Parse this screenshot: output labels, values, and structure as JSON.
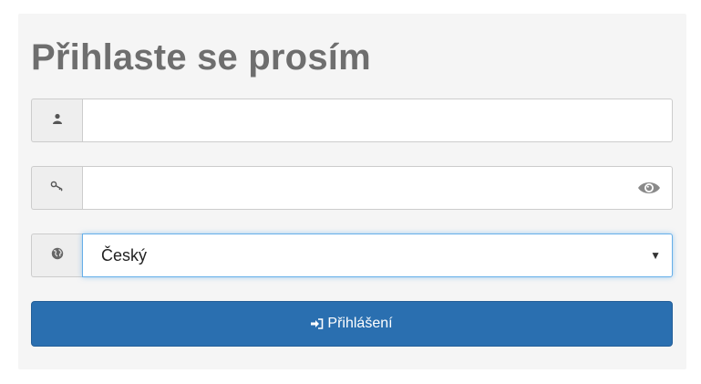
{
  "login": {
    "title": "Přihlaste se prosím",
    "username": {
      "icon": "user-icon",
      "value": "",
      "placeholder": ""
    },
    "password": {
      "icon": "key-icon",
      "toggle_icon": "eye-icon",
      "value": "",
      "placeholder": ""
    },
    "language": {
      "icon": "globe-icon",
      "selected": "Český"
    },
    "submit": {
      "icon": "sign-in-icon",
      "label": "Přihlášení"
    }
  },
  "colors": {
    "title": "#6e6e6e",
    "button": "#2a6fb0",
    "focus": "#66afe9"
  }
}
